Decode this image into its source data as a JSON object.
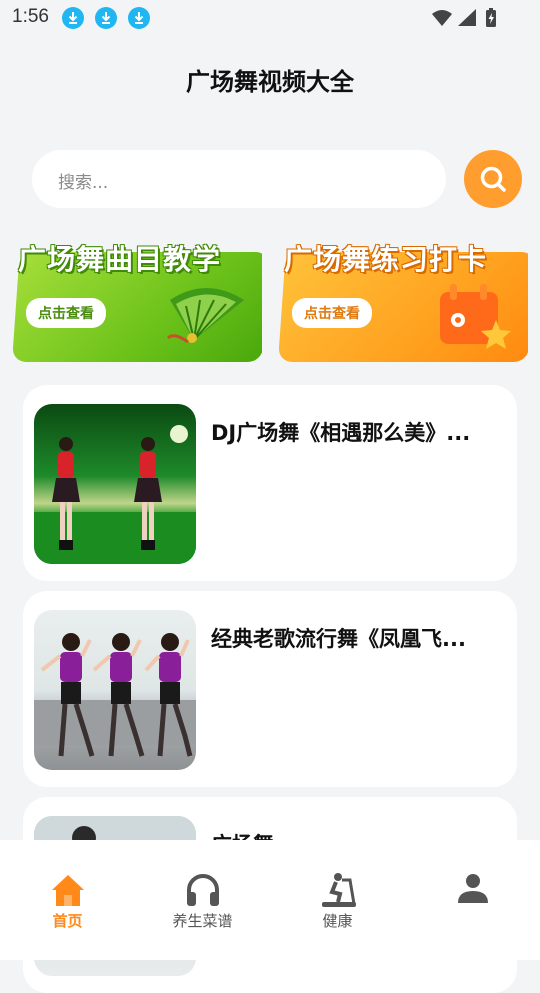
{
  "status_bar": {
    "time": "1:56",
    "download_icon_count": 3,
    "accent": "#1fb6f2"
  },
  "header": {
    "title": "广场舞视频大全"
  },
  "search": {
    "placeholder": "搜索...",
    "button_color": "#ff9d2e"
  },
  "banners": [
    {
      "title": "广场舞曲目教学",
      "cta": "点击查看",
      "theme": "green"
    },
    {
      "title": "广场舞练习打卡",
      "cta": "点击查看",
      "theme": "orange"
    }
  ],
  "videos": [
    {
      "title": "DJ广场舞《相遇那么美》..."
    },
    {
      "title": "经典老歌流行舞《凤凰飞..."
    },
    {
      "title": "广场舞"
    }
  ],
  "bottom_nav": {
    "active_color": "#ff8a1a",
    "items": [
      {
        "label": "首页",
        "icon": "home-icon",
        "active": true
      },
      {
        "label": "养生菜谱",
        "icon": "headphones-icon",
        "active": false
      },
      {
        "label": "健康",
        "icon": "treadmill-icon",
        "active": false
      },
      {
        "label": "",
        "icon": "profile-icon",
        "active": false
      }
    ]
  }
}
